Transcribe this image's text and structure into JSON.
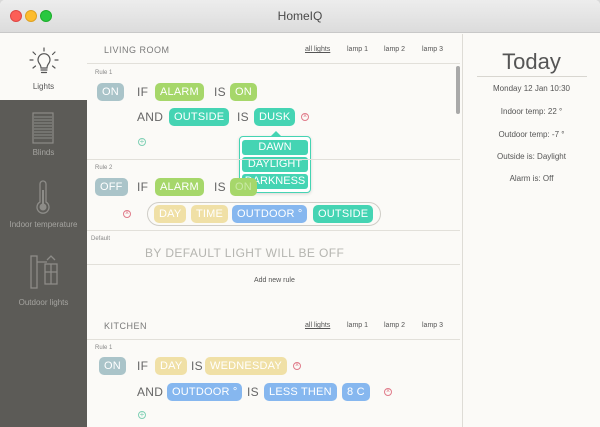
{
  "window": {
    "title": "HomeIQ"
  },
  "sidebar": {
    "items": [
      {
        "label": "Lights",
        "icon": "lightbulb-icon",
        "active": true
      },
      {
        "label": "Blinds",
        "icon": "blinds-icon",
        "active": false
      },
      {
        "label": "Indoor temperature",
        "icon": "thermometer-icon",
        "active": false
      },
      {
        "label": "Outdoor lights",
        "icon": "outdoor-lamp-icon",
        "active": false
      }
    ]
  },
  "living_room": {
    "title": "LIVING ROOM",
    "tabs": [
      "all lights",
      "lamp 1",
      "lamp 2",
      "lamp 3"
    ],
    "rule1": {
      "label": "Rule 1",
      "state": "ON",
      "if": "IF",
      "cond1": "ALARM",
      "is1": "IS",
      "val1": "ON",
      "and": "AND",
      "cond2": "OUTSIDE",
      "is2": "IS",
      "val2": "DUSK",
      "dropdown": [
        "DAWN",
        "DAYLIGHT",
        "DARKNESS"
      ]
    },
    "rule2": {
      "label": "Rule 2",
      "state": "OFF",
      "if": "IF",
      "cond1": "ALARM",
      "is1": "IS",
      "val1": "ON",
      "options": [
        "DAY",
        "TIME",
        "OUTDOOR °",
        "OUTSIDE"
      ]
    },
    "default": {
      "label": "Default",
      "text": "BY DEFAULT LIGHT WILL BE OFF"
    },
    "add_rule": "Add new rule"
  },
  "kitchen": {
    "title": "KITCHEN",
    "tabs": [
      "all lights",
      "lamp 1",
      "lamp 2",
      "lamp 3"
    ],
    "rule1": {
      "label": "Rule 1",
      "state": "ON",
      "if": "IF",
      "cond1": "DAY",
      "is1": "IS",
      "val1": "WEDNESDAY",
      "and": "AND",
      "cond2": "OUTDOOR °",
      "is2": "IS",
      "op": "LESS THEN",
      "val2": "8 C"
    }
  },
  "today": {
    "title": "Today",
    "date": "Monday 12 Jan 10:30",
    "indoor": "Indoor temp: 22 °",
    "outdoor": "Outdoor temp: -7 °",
    "outside": "Outside is: Daylight",
    "alarm": "Alarm is: Off"
  },
  "colors": {
    "sidebar": "#5c5b57",
    "green": "#a6d76a",
    "teal": "#45d4b3",
    "blue": "#86b7ef",
    "yellow": "#f0e0a6"
  }
}
